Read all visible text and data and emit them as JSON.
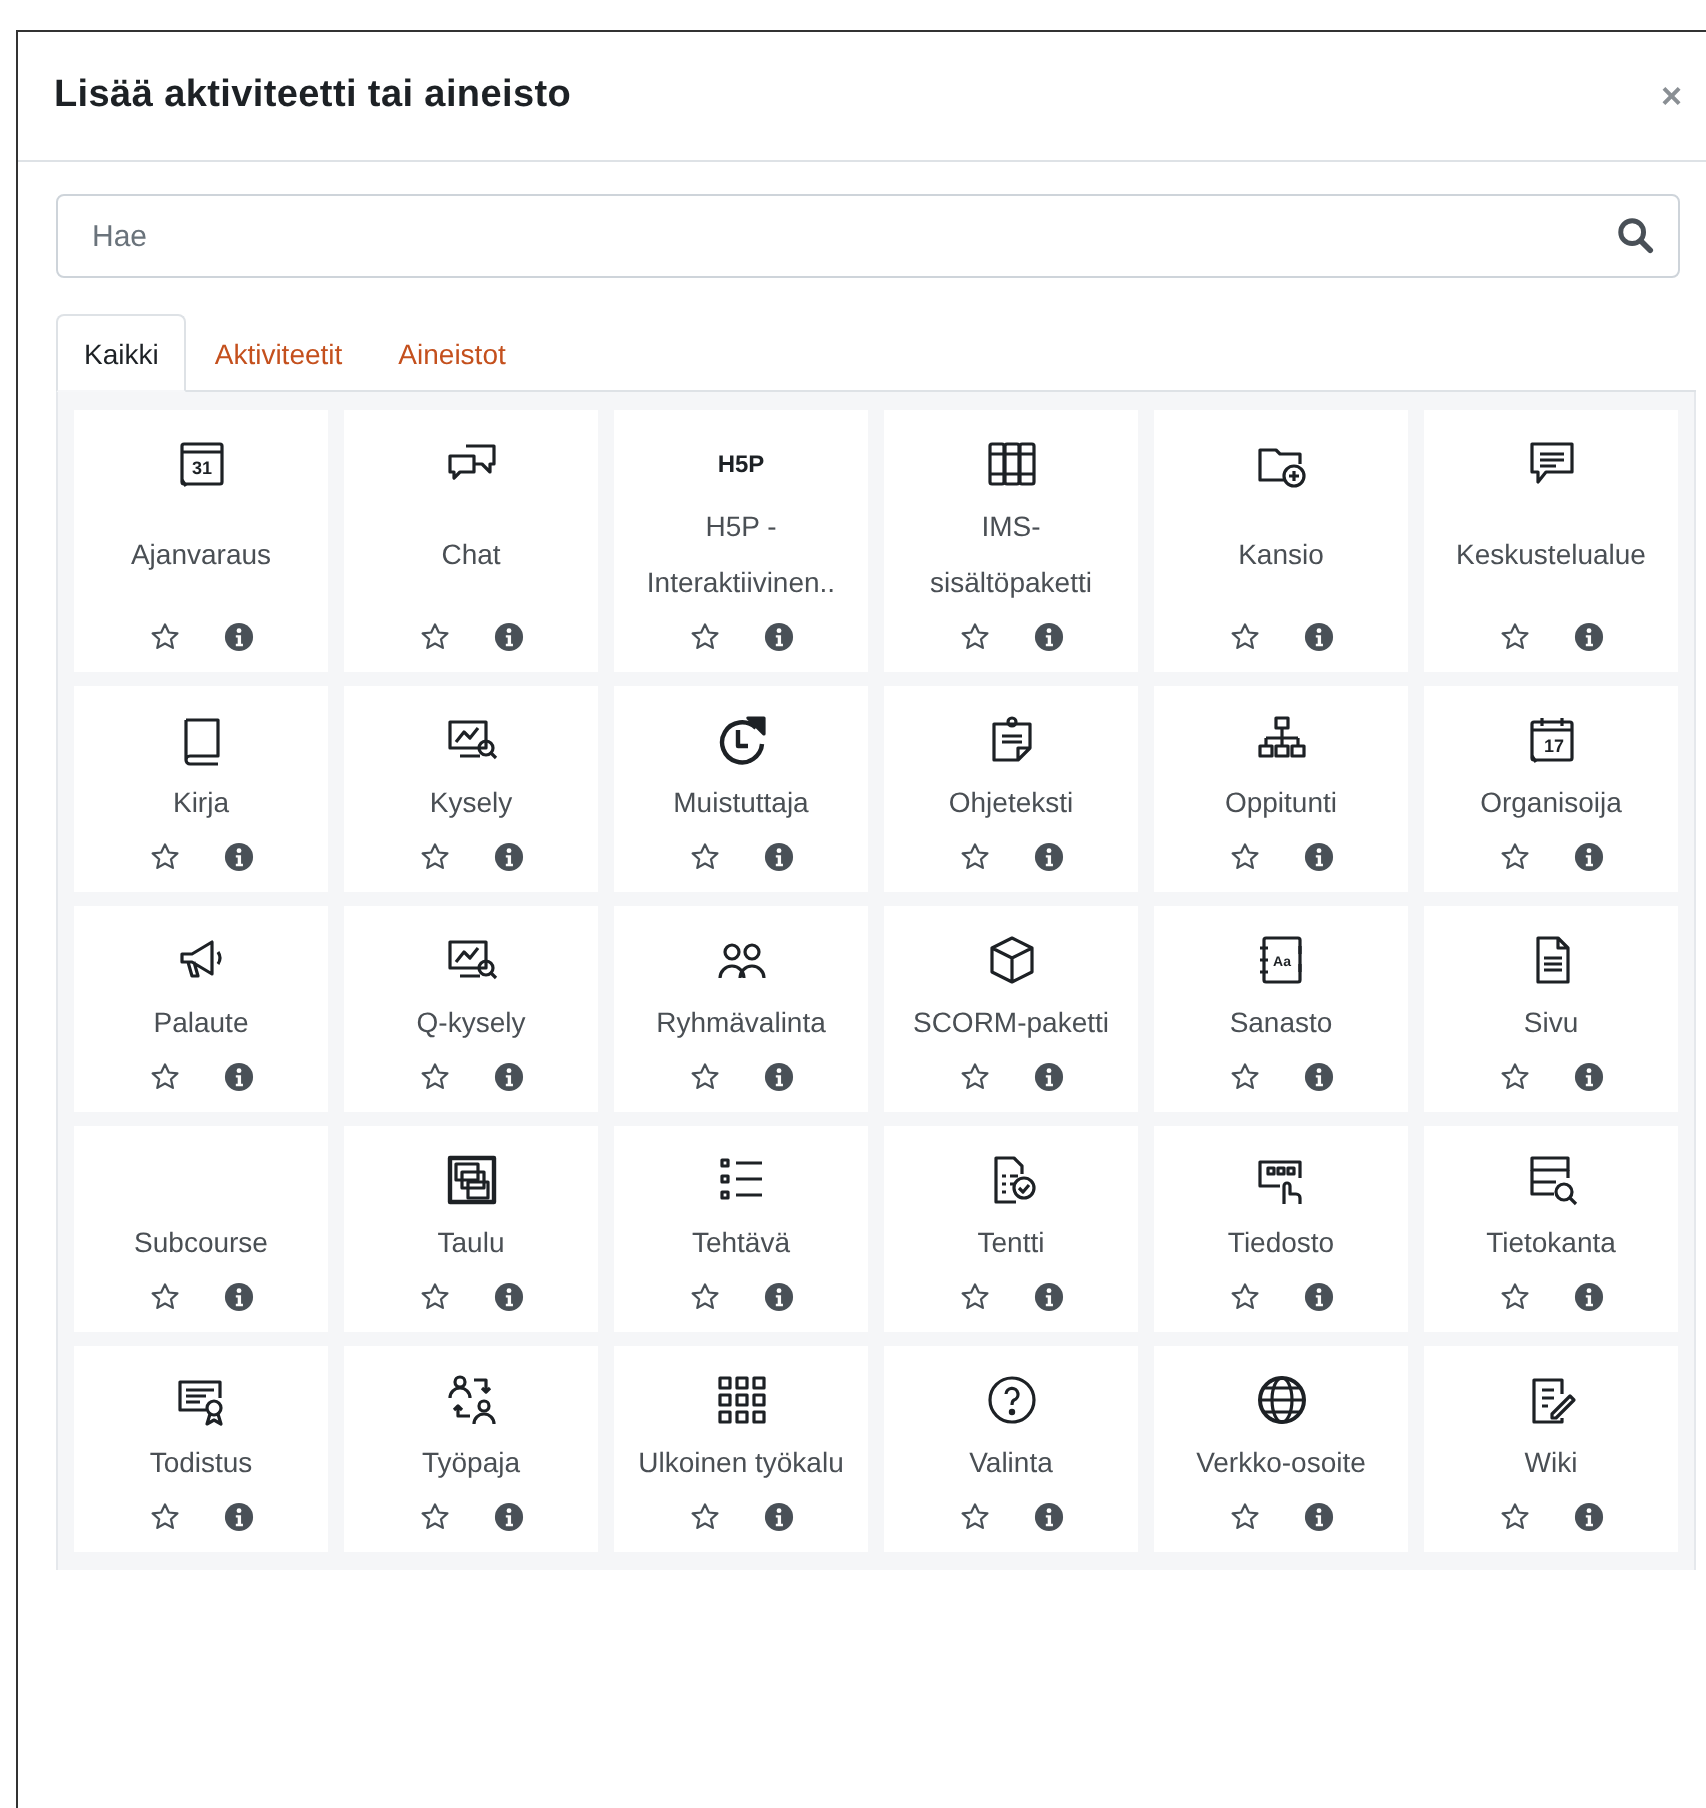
{
  "dialog": {
    "title": "Lisää aktiviteetti tai aineisto",
    "close": "×"
  },
  "search": {
    "placeholder": "Hae"
  },
  "tabs": [
    {
      "label": "Kaikki",
      "selected": true
    },
    {
      "label": "Aktiviteetit",
      "selected": false
    },
    {
      "label": "Aineistot",
      "selected": false
    }
  ],
  "items": [
    {
      "label": "Ajanvaraus",
      "icon_text": "31",
      "starred": false
    },
    {
      "label": "Chat",
      "starred": false
    },
    {
      "label": "H5P - Interaktiivinen..",
      "icon_text": "H5P",
      "starred": false
    },
    {
      "label": "IMS-sisältöpaketti",
      "starred": false
    },
    {
      "label": "Kansio",
      "starred": false
    },
    {
      "label": "Keskustelualue",
      "starred": false
    },
    {
      "label": "Kirja",
      "starred": false
    },
    {
      "label": "Kysely",
      "starred": false
    },
    {
      "label": "Muistuttaja",
      "starred": false
    },
    {
      "label": "Ohjeteksti",
      "starred": false
    },
    {
      "label": "Oppitunti",
      "starred": false
    },
    {
      "label": "Organisoija",
      "icon_text": "17",
      "starred": false
    },
    {
      "label": "Palaute",
      "starred": false
    },
    {
      "label": "Q-kysely",
      "starred": false
    },
    {
      "label": "Ryhmävalinta",
      "starred": false
    },
    {
      "label": "SCORM-paketti",
      "starred": false
    },
    {
      "label": "Sanasto",
      "icon_text": "Aa",
      "starred": false
    },
    {
      "label": "Sivu",
      "starred": false
    },
    {
      "label": "Subcourse",
      "starred": false
    },
    {
      "label": "Taulu",
      "starred": false
    },
    {
      "label": "Tehtävä",
      "starred": false
    },
    {
      "label": "Tentti",
      "starred": false
    },
    {
      "label": "Tiedosto",
      "starred": false
    },
    {
      "label": "Tietokanta",
      "starred": false
    },
    {
      "label": "Todistus",
      "starred": false
    },
    {
      "label": "Työpaja",
      "starred": false
    },
    {
      "label": "Ulkoinen työkalu",
      "starred": false
    },
    {
      "label": "Valinta",
      "starred": false
    },
    {
      "label": "Verkko-osoite",
      "starred": false
    },
    {
      "label": "Wiki",
      "starred": false
    }
  ]
}
